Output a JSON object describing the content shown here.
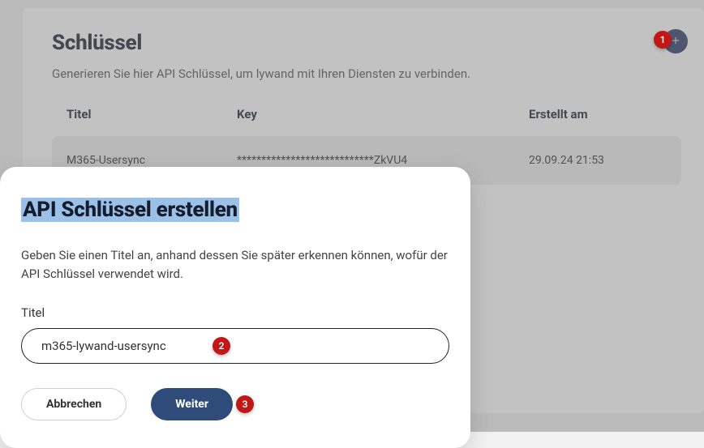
{
  "page": {
    "title": "Schlüssel",
    "subtitle": "Generieren Sie hier API Schlüssel, um lywand mit Ihren Diensten zu verbinden.",
    "columns": {
      "title": "Titel",
      "key": "Key",
      "created": "Erstellt am"
    },
    "rows": [
      {
        "title": "M365-Usersync",
        "key": "****************************ZkVU4",
        "created": "29.09.24 21:53"
      }
    ]
  },
  "modal": {
    "title": "API Schlüssel erstellen",
    "description": "Geben Sie einen Titel an, anhand dessen Sie später erkennen können, wofür der API Schlüssel verwendet wird.",
    "field_label": "Titel",
    "field_value": "m365-lywand-usersync",
    "cancel": "Abbrechen",
    "next": "Weiter"
  },
  "badges": {
    "b1": "1",
    "b2": "2",
    "b3": "3"
  }
}
